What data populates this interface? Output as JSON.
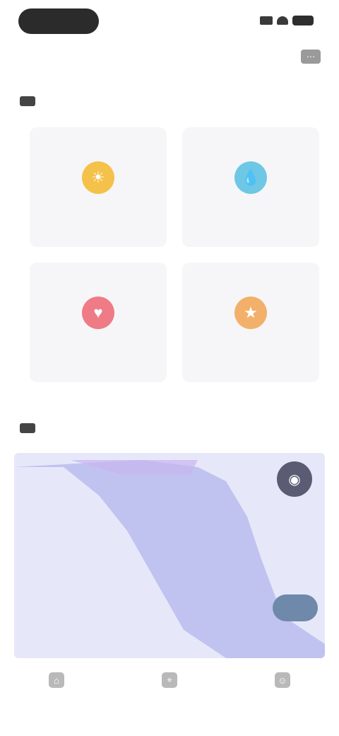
{
  "status_bar": {
    "time": ""
  },
  "header": {
    "action_icon": "more-icon"
  },
  "section_shortcuts": {
    "title": ""
  },
  "shortcuts": [
    {
      "icon": "sun-icon",
      "color": "#f4c24a",
      "line1": "",
      "line2": ""
    },
    {
      "icon": "drop-icon",
      "color": "#6fc7e6",
      "line1": "",
      "line2": ""
    },
    {
      "icon": "heart-icon",
      "color": "#ef7b86",
      "line1": "",
      "line2": ""
    },
    {
      "icon": "star-icon",
      "color": "#f3b06a",
      "line1": "",
      "line2": ""
    }
  ],
  "section_map": {
    "title": ""
  },
  "map": {
    "background_color": "#e6e8fa",
    "region_color": "#b8bcec",
    "fab_icon": "layers-icon",
    "pill_label": ""
  },
  "bottom_nav": [
    {
      "icon": "home-icon",
      "label": ""
    },
    {
      "icon": "location-icon",
      "label": ""
    },
    {
      "icon": "user-icon",
      "label": ""
    }
  ]
}
